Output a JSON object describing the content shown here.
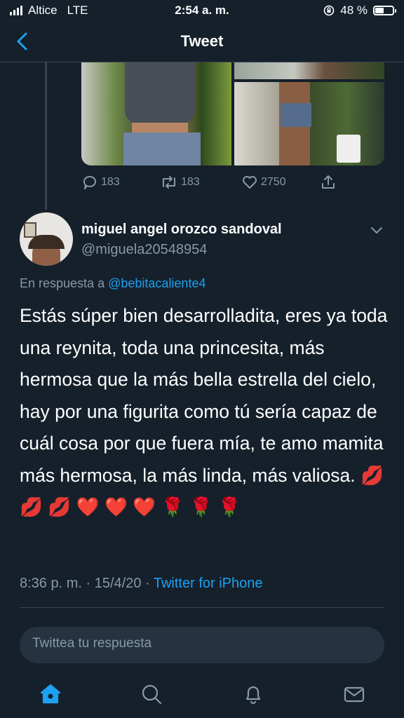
{
  "status_bar": {
    "carrier": "Altice",
    "network": "LTE",
    "time": "2:54 a. m.",
    "battery_percent": "48 %",
    "battery_level": 0.48
  },
  "nav": {
    "title": "Tweet",
    "back_icon": "chevron-left-icon"
  },
  "previous_tweet": {
    "actions": {
      "replies": "183",
      "retweets": "183",
      "likes": "2750"
    }
  },
  "tweet": {
    "display_name": "miguel angel orozco sandoval",
    "handle": "@miguela20548954",
    "reply_prefix": "En respuesta a ",
    "reply_mention": "@bebitacaliente4",
    "text": "Estás súper bien desarrolladita, eres ya toda una reynita, toda una princesita, más hermosa que la más bella estrella del cielo, hay por una figurita como tú sería capaz de cuál cosa por que fuera mía, te amo mamita más hermosa, la más linda, más valiosa. 💋 💋 💋 ❤️ ❤️ ❤️ 🌹 🌹 🌹",
    "time": "8:36 p. m.",
    "date": "15/4/20",
    "separator": " · ",
    "source": "Twitter for iPhone"
  },
  "reply_box": {
    "placeholder": "Twittea tu respuesta"
  },
  "tab_bar": {
    "items": [
      "home-icon",
      "search-icon",
      "bell-icon",
      "mail-icon"
    ],
    "active": "home-icon"
  },
  "colors": {
    "background": "#15202b",
    "accent": "#1da1f2",
    "muted": "#8899a6",
    "border": "#38444d"
  }
}
